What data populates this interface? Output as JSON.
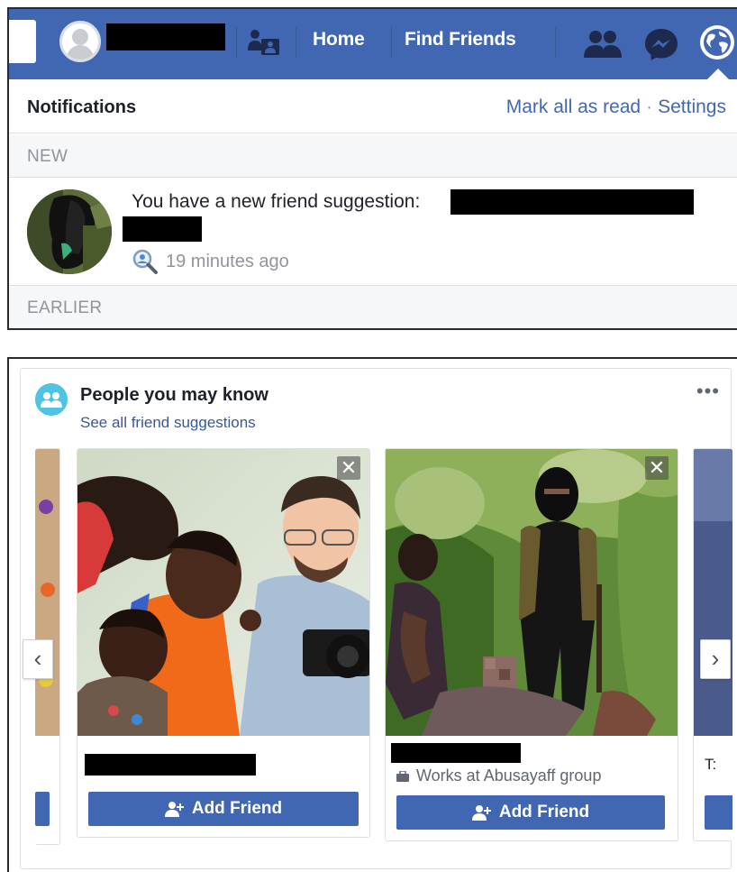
{
  "topbar": {
    "nav": {
      "home": "Home",
      "find_friends": "Find Friends"
    },
    "icons": [
      "friend-requests-icon",
      "friends-icon",
      "messenger-icon",
      "notifications-globe-icon"
    ],
    "color": "#4267b2"
  },
  "notifications": {
    "title": "Notifications",
    "mark_all": "Mark all as read",
    "separator": "·",
    "settings": "Settings",
    "section_new": "NEW",
    "section_earlier": "EARLIER",
    "items": [
      {
        "text": "You have a new friend suggestion:",
        "time": "19 minutes ago"
      }
    ]
  },
  "pymk": {
    "title": "People you may know",
    "see_all": "See all friend suggestions",
    "more": "•••",
    "prev_arrow": "‹",
    "next_arrow": "›",
    "cards": [
      {
        "add_label": "Add Friend",
        "close": "✕"
      },
      {
        "works": "Works at Abusayaff group",
        "add_label": "Add Friend",
        "close": "✕"
      }
    ],
    "partial_right_text": "T:"
  }
}
